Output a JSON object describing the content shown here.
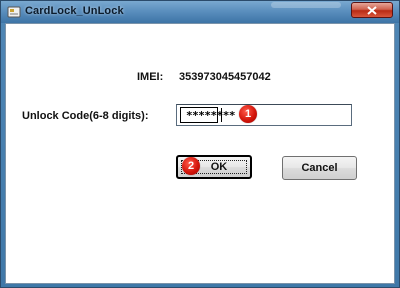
{
  "window": {
    "title": "CardLock_UnLock"
  },
  "form": {
    "imei_label": "IMEI:",
    "imei_value": "353973045457042",
    "code_label": "Unlock Code(6-8 digits):",
    "code_value": "********"
  },
  "annotations": {
    "badge_1": "1",
    "badge_2": "2"
  },
  "buttons": {
    "ok_label": "OK",
    "cancel_label": "Cancel"
  },
  "colors": {
    "badge": "#d4160b",
    "titlebar": "#4f86b5",
    "close_button": "#c83a22"
  },
  "icons": {
    "title_icon": "card-lock-icon",
    "close_icon": "close-icon"
  }
}
